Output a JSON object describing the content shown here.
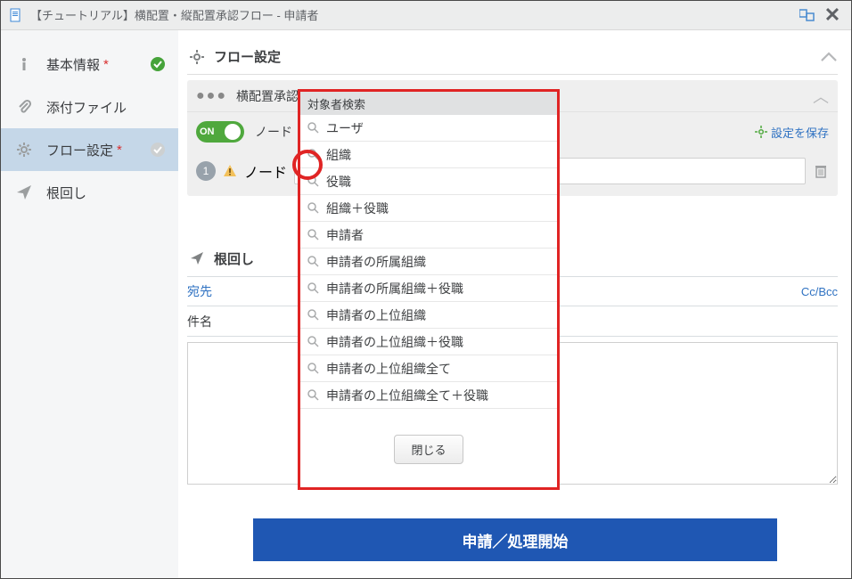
{
  "titlebar": {
    "title": "【チュートリアル】横配置・縦配置承認フロー - 申請者"
  },
  "nav": {
    "items": [
      {
        "label": "基本情報",
        "required": true,
        "status": "ok",
        "icon": "info-icon"
      },
      {
        "label": "添付ファイル",
        "required": false,
        "status": "",
        "icon": "paperclip-icon"
      },
      {
        "label": "フロー設定",
        "required": true,
        "status": "pending",
        "icon": "gear-icon"
      },
      {
        "label": "根回し",
        "required": false,
        "status": "",
        "icon": "send-icon"
      }
    ]
  },
  "flow": {
    "header": "フロー設定",
    "approver_row": "横配置承認",
    "toggle_text": "ON",
    "node_toggle_label": "ノード",
    "save_label": "設定を保存",
    "node_badge": "1",
    "node_label": "ノード"
  },
  "nemawashi": {
    "header": "根回し",
    "to_label": "宛先",
    "ccbcc_label": "Cc/Bcc",
    "subject_label": "件名"
  },
  "submit": {
    "label": "申請／処理開始"
  },
  "popup": {
    "title": "対象者検索",
    "items": [
      "ユーザ",
      "組織",
      "役職",
      "組織＋役職",
      "申請者",
      "申請者の所属組織",
      "申請者の所属組織＋役職",
      "申請者の上位組織",
      "申請者の上位組織＋役職",
      "申請者の上位組織全て",
      "申請者の上位組織全て＋役職"
    ],
    "close": "閉じる"
  },
  "required_mark": "*"
}
